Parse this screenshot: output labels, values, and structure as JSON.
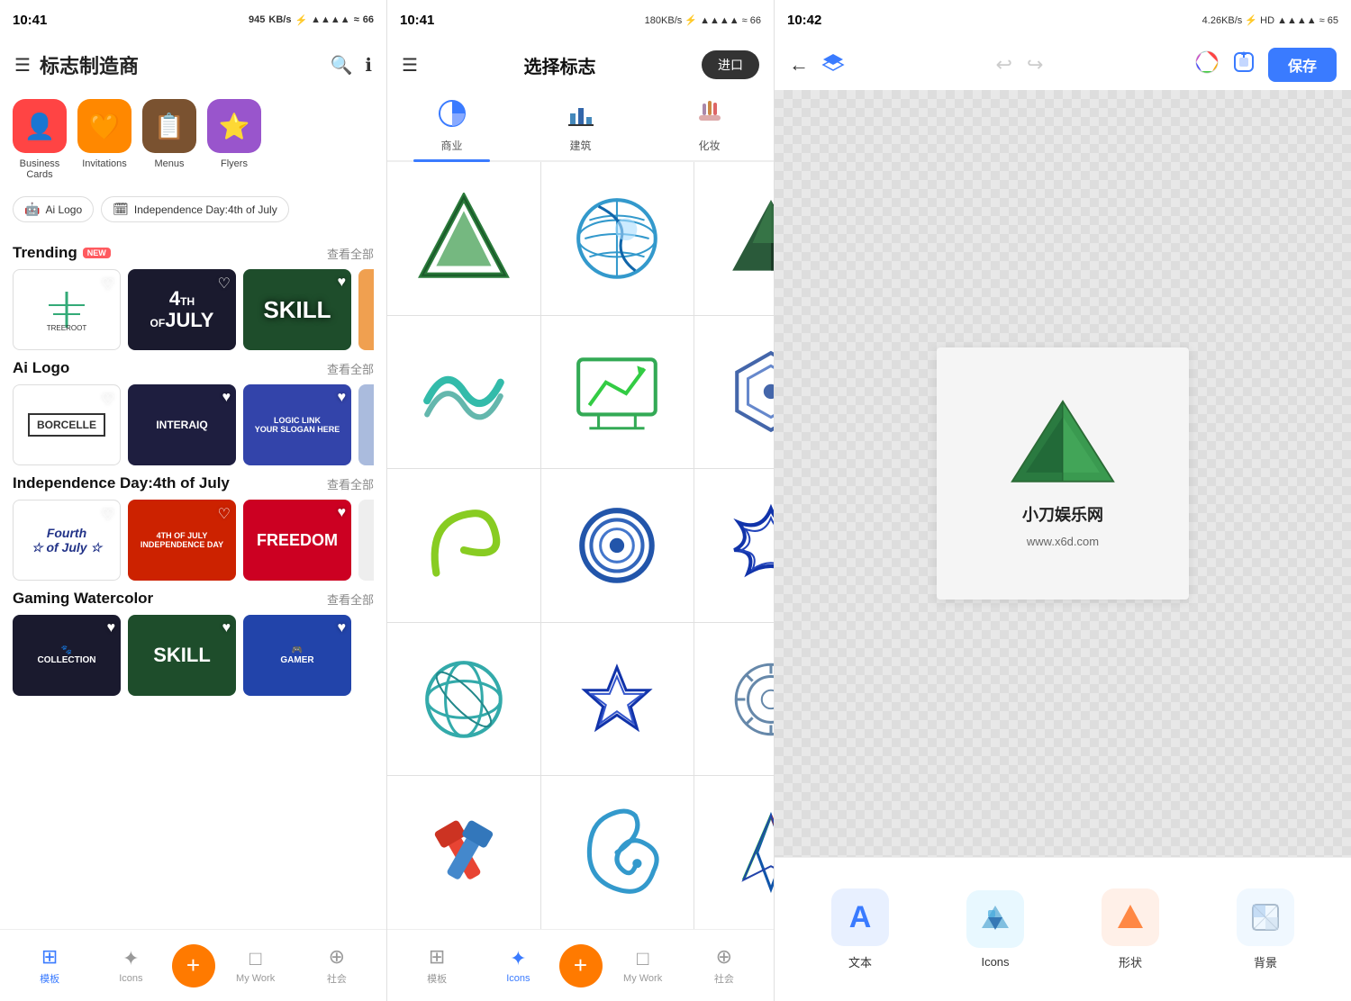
{
  "panel1": {
    "status": {
      "time": "10:41",
      "icons": "945KB/s ⚡ HD ▲▲▲▲ ≈ 66"
    },
    "header": {
      "title": "标志制造商",
      "menu_icon": "☰",
      "search_icon": "🔍",
      "info_icon": "ℹ"
    },
    "categories": [
      {
        "id": "business-cards",
        "label": "Business\nCards",
        "icon": "👤",
        "bg": "#ff4444"
      },
      {
        "id": "invitations",
        "label": "Invitations",
        "icon": "🧡",
        "bg": "#ff8800"
      },
      {
        "id": "menus",
        "label": "Menus",
        "icon": "📋",
        "bg": "#7a5230"
      },
      {
        "id": "flyers",
        "label": "Flyers",
        "icon": "⭐",
        "bg": "#9955cc"
      }
    ],
    "tags": [
      {
        "id": "ai-logo",
        "label": "Ai Logo",
        "icon": "🤖"
      },
      {
        "id": "independence-day",
        "label": "Independence Day:4th of July",
        "icon": "🗓"
      }
    ],
    "sections": [
      {
        "id": "trending",
        "title": "Trending",
        "is_new": true,
        "view_all": "查看全部",
        "cards": [
          "treeroot",
          "4th",
          "skill",
          "partial"
        ]
      },
      {
        "id": "ai-logo",
        "title": "Ai Logo",
        "is_new": false,
        "view_all": "查看全部",
        "cards": [
          "borcelle",
          "interaiq",
          "logiclink",
          "circle"
        ]
      },
      {
        "id": "independence-day",
        "title": "Independence Day:4th of July",
        "is_new": false,
        "view_all": "查看全部",
        "cards": [
          "fourth",
          "4thjuly",
          "freedom",
          "partial2"
        ]
      },
      {
        "id": "gaming-watercolor",
        "title": "Gaming Watercolor",
        "is_new": false,
        "view_all": "查看全部",
        "cards": [
          "gaming1",
          "gaming2",
          "gaming3"
        ]
      }
    ],
    "bottom_nav": [
      {
        "id": "templates",
        "label": "模板",
        "icon": "⊞",
        "active": true
      },
      {
        "id": "icons",
        "label": "Icons",
        "icon": "✦",
        "active": false
      },
      {
        "id": "add",
        "label": "+",
        "is_add": true
      },
      {
        "id": "my-work",
        "label": "My Work",
        "icon": "□",
        "active": false
      },
      {
        "id": "social",
        "label": "社会",
        "icon": "⊕",
        "active": false
      }
    ]
  },
  "panel2": {
    "status": {
      "time": "10:41",
      "icons": "180KB/s ⚡ HD ▲▲▲▲ ≈ 66"
    },
    "header": {
      "menu_icon": "☰",
      "title": "选择标志",
      "import_label": "进口"
    },
    "tabs": [
      {
        "id": "business",
        "label": "商业",
        "icon": "📊",
        "active": true
      },
      {
        "id": "architecture",
        "label": "建筑",
        "icon": "🏙",
        "active": false
      },
      {
        "id": "makeup",
        "label": "化妆",
        "icon": "💄",
        "active": false
      }
    ],
    "logos": [
      "triangle-green",
      "globe-blue",
      "triangle-dark",
      "waves-teal",
      "chart-screen",
      "hexagon",
      "curve-green",
      "circle-rings",
      "star-cross",
      "sphere-teal",
      "star-knot",
      "gear-circle",
      "hammer-cross",
      "swirl-blue",
      "arrows-sharp"
    ],
    "bottom_nav": [
      {
        "id": "templates",
        "label": "模板",
        "icon": "⊞",
        "active": false
      },
      {
        "id": "icons",
        "label": "Icons",
        "icon": "✦",
        "active": true
      },
      {
        "id": "add",
        "label": "+",
        "is_add": true
      },
      {
        "id": "my-work",
        "label": "My Work",
        "icon": "□",
        "active": false
      },
      {
        "id": "social",
        "label": "社会",
        "icon": "⊕",
        "active": false
      }
    ]
  },
  "panel3": {
    "status": {
      "time": "10:42",
      "icons": "4.26KB/s ⚡ HD ▲▲▲▲ ≈ 65"
    },
    "toolbar": {
      "back_icon": "←",
      "layers_icon": "◆",
      "undo_icon": "↩",
      "redo_icon": "↪",
      "color_icon": "🌈",
      "share_icon": "⊡",
      "save_label": "保存"
    },
    "canvas": {
      "company_name": "小刀娱乐网",
      "company_url": "www.x6d.com"
    },
    "bottom_tools": [
      {
        "id": "text",
        "label": "文本",
        "icon": "A"
      },
      {
        "id": "icons",
        "label": "Icons",
        "icon": "◈"
      },
      {
        "id": "shapes",
        "label": "形状",
        "icon": "▲"
      },
      {
        "id": "background",
        "label": "背景",
        "icon": "🖼"
      }
    ]
  }
}
